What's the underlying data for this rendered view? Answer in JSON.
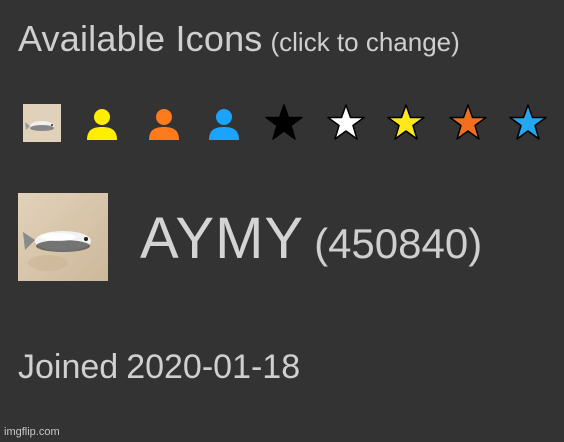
{
  "header": {
    "title": "Available Icons",
    "hint": "(click to change)"
  },
  "icon_options": [
    {
      "name": "fish-avatar-icon",
      "type": "image"
    },
    {
      "name": "person-yellow-icon",
      "type": "person",
      "color": "#ffee00"
    },
    {
      "name": "person-orange-icon",
      "type": "person",
      "color": "#ff7a1a"
    },
    {
      "name": "person-blue-icon",
      "type": "person",
      "color": "#1aa3ff"
    },
    {
      "name": "star-black-icon",
      "type": "star",
      "color": "#000000"
    },
    {
      "name": "star-white-icon",
      "type": "star",
      "color": "#ffffff"
    },
    {
      "name": "star-yellow-icon",
      "type": "star",
      "color": "#ffe81a"
    },
    {
      "name": "star-orange-icon",
      "type": "star",
      "color": "#f36f20"
    },
    {
      "name": "star-blue-icon",
      "type": "star",
      "color": "#22a7f0"
    }
  ],
  "profile": {
    "username": "AYMY",
    "user_id": "(450840)",
    "joined_label": "Joined",
    "joined_date": "2020-01-18"
  },
  "watermark": "imgflip.com",
  "colors": {
    "background": "#333333",
    "text": "#d4d4d4"
  }
}
